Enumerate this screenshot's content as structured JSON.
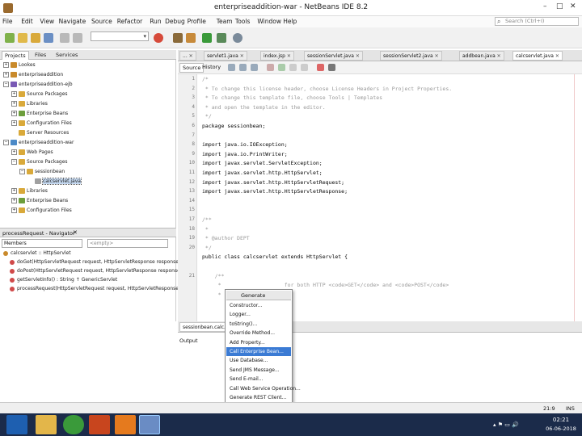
{
  "window": {
    "title": "enterpriseaddition-war - NetBeans IDE 8.2",
    "min": "–",
    "max": "□",
    "close": "✕"
  },
  "menu": [
    "File",
    "Edit",
    "View",
    "Navigate",
    "Source",
    "Refactor",
    "Run",
    "Debug",
    "Profile",
    "Team",
    "Tools",
    "Window",
    "Help"
  ],
  "search": {
    "placeholder": "Search (Ctrl+I)"
  },
  "projects": {
    "tabs": [
      "Projects",
      "Files",
      "Services"
    ],
    "tree": [
      {
        "label": "Lookes",
        "level": 0,
        "exp": "+",
        "color": "#c98a2b"
      },
      {
        "label": "enterpriseaddition",
        "level": 0,
        "exp": "+",
        "color": "#c98a2b"
      },
      {
        "label": "enterpriseaddition-ejb",
        "level": 0,
        "exp": "−",
        "color": "#7a5ab5"
      },
      {
        "label": "Source Packages",
        "level": 1,
        "exp": "+",
        "color": "#d9a93a"
      },
      {
        "label": "Libraries",
        "level": 1,
        "exp": "+",
        "color": "#d9a93a"
      },
      {
        "label": "Enterprise Beans",
        "level": 1,
        "exp": "+",
        "color": "#6d9e3c"
      },
      {
        "label": "Configuration Files",
        "level": 1,
        "exp": "+",
        "color": "#d9a93a"
      },
      {
        "label": "Server Resources",
        "level": 1,
        "exp": "",
        "color": "#d9a93a"
      },
      {
        "label": "enterpriseaddition-war",
        "level": 0,
        "exp": "−",
        "color": "#4c8ac7"
      },
      {
        "label": "Web Pages",
        "level": 1,
        "exp": "+",
        "color": "#d9a93a"
      },
      {
        "label": "Source Packages",
        "level": 1,
        "exp": "−",
        "color": "#d9a93a"
      },
      {
        "label": "sessionbean",
        "level": 2,
        "exp": "−",
        "color": "#d9a93a"
      },
      {
        "label": "calcservlet.java",
        "level": 3,
        "exp": "",
        "color": "#a0a0a0",
        "selected": true
      },
      {
        "label": "Libraries",
        "level": 1,
        "exp": "+",
        "color": "#d9a93a"
      },
      {
        "label": "Enterprise Beans",
        "level": 1,
        "exp": "+",
        "color": "#6d9e3c"
      },
      {
        "label": "Configuration Files",
        "level": 1,
        "exp": "+",
        "color": "#d9a93a"
      }
    ]
  },
  "navigator": {
    "title": "processRequest - Navigator",
    "filter": "Members",
    "empty_combo": "<empty>",
    "items": [
      {
        "label": "calcservlet :: HttpServlet",
        "color": "#c98a2b",
        "indent": 4
      },
      {
        "label": "doGet(HttpServletRequest request, HttpServletResponse response) : void",
        "color": "#d04a4a",
        "indent": 12
      },
      {
        "label": "doPost(HttpServletRequest request, HttpServletResponse response) : void",
        "color": "#d04a4a",
        "indent": 12
      },
      {
        "label": "getServletInfo() : String ↑ GenericServlet",
        "color": "#d04a4a",
        "indent": 12
      },
      {
        "label": "processRequest(HttpServletRequest request, HttpServletResponse response)",
        "color": "#d04a4a",
        "indent": 12
      }
    ]
  },
  "editor": {
    "tabs": [
      "...",
      "servlet1.java",
      "index.jsp",
      "sessionServlet.java",
      "sessionServlet2.java",
      "addbean.java",
      "calcservlet.java"
    ],
    "active_tab": 6,
    "source_label": "Source",
    "history_label": "History",
    "lines": [
      {
        "n": "1",
        "t": "/*",
        "c": "cmt"
      },
      {
        "n": "2",
        "t": " * To change this license header, choose License Headers in Project Properties.",
        "c": "cmt"
      },
      {
        "n": "3",
        "t": " * To change this template file, choose Tools | Templates",
        "c": "cmt"
      },
      {
        "n": "4",
        "t": " * and open the template in the editor.",
        "c": "cmt"
      },
      {
        "n": "5",
        "t": " */",
        "c": "cmt"
      },
      {
        "n": "6",
        "t": "package sessionbean;",
        "c": "kw"
      },
      {
        "n": "7",
        "t": "",
        "c": "kw"
      },
      {
        "n": "8",
        "t": "import java.io.IOException;",
        "c": "kw"
      },
      {
        "n": "9",
        "t": "import java.io.PrintWriter;",
        "c": "kw"
      },
      {
        "n": "10",
        "t": "import javax.servlet.ServletException;",
        "c": "kw"
      },
      {
        "n": "11",
        "t": "import javax.servlet.http.HttpServlet;",
        "c": "kw"
      },
      {
        "n": "12",
        "t": "import javax.servlet.http.HttpServletRequest;",
        "c": "kw"
      },
      {
        "n": "13",
        "t": "import javax.servlet.http.HttpServletResponse;",
        "c": "kw"
      },
      {
        "n": "14",
        "t": "",
        "c": "kw"
      },
      {
        "n": "15",
        "t": "",
        "c": "kw"
      },
      {
        "n": "17",
        "t": "/**",
        "c": "cmt"
      },
      {
        "n": "18",
        "t": " *",
        "c": "cmt"
      },
      {
        "n": "19",
        "t": " * @author DEPT",
        "c": "cmt"
      },
      {
        "n": "20",
        "t": " */",
        "c": "cmt"
      },
      {
        "n": "",
        "t": "public class calcservlet extends HttpServlet {",
        "c": "kw"
      },
      {
        "n": "",
        "t": "",
        "c": "kw"
      },
      {
        "n": "21",
        "t": "    /**",
        "c": "cmt"
      },
      {
        "n": "",
        "t": "     *                    for both HTTP <code>GET</code> and <code>POST</code>",
        "c": "cmt"
      },
      {
        "n": "",
        "t": "     *",
        "c": "cmt"
      }
    ]
  },
  "output": {
    "tabs": [
      "sessionbean.calc..."
    ],
    "label": "Output"
  },
  "generate": {
    "title": "Generate",
    "items": [
      "Constructor...",
      "Logger...",
      "toString()...",
      "Override Method...",
      "Add Property...",
      "Call Enterprise Bean...",
      "Use Database...",
      "Send JMS Message...",
      "Send E-mail...",
      "Call Web Service Operation...",
      "Generate REST Client..."
    ],
    "selected": 5
  },
  "status": {
    "position": "21:9",
    "mode": "INS"
  },
  "taskbar": {
    "time": "02:21",
    "date": "06-06-2018"
  }
}
